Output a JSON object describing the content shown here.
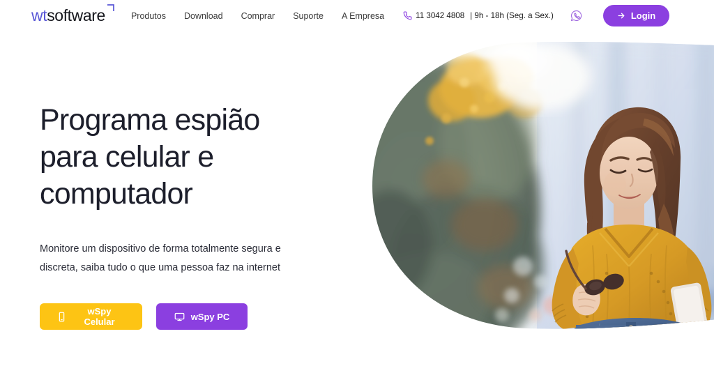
{
  "header": {
    "logo": {
      "part1": "wt",
      "part2": "software",
      "mark": "corner-bracket-mark",
      "color_part1": "#5856d6",
      "color_part2": "#16171d"
    },
    "nav": [
      {
        "label": "Produtos"
      },
      {
        "label": "Download"
      },
      {
        "label": "Comprar"
      },
      {
        "label": "Suporte"
      },
      {
        "label": "A Empresa"
      }
    ],
    "contact": {
      "icon": "phone-icon",
      "number": "11 3042 4808",
      "hours": "| 9h - 18h (Seg. a Sex.)",
      "whatsapp_icon": "whatsapp-icon"
    },
    "login": {
      "label": "Login",
      "icon": "sign-in-arrow-icon",
      "color": "#8b3fe0"
    }
  },
  "hero": {
    "title_line1": "Programa espião",
    "title_line2": "para celular e",
    "title_line3": "computador",
    "subtitle_line1": "Monitore um dispositivo de forma totalmente segura e",
    "subtitle_line2": "discreta, saiba tudo o que uma pessoa faz na internet",
    "cta_mobile": {
      "label": "wSpy Celular",
      "icon": "mobile-phone-icon",
      "color": "#fdc414"
    },
    "cta_pc": {
      "label": "wSpy PC",
      "icon": "desktop-monitor-icon",
      "color": "#8b3fe0"
    },
    "photo": {
      "alt": "woman-in-yellow-sweater-using-smartphone",
      "shape": "rounded-blob-mask",
      "sweater_color": "#d9971a",
      "skirt_color": "#3f5d8c",
      "foliage_color": "#6d7a66",
      "wall_color": "#cfd9e6"
    }
  }
}
